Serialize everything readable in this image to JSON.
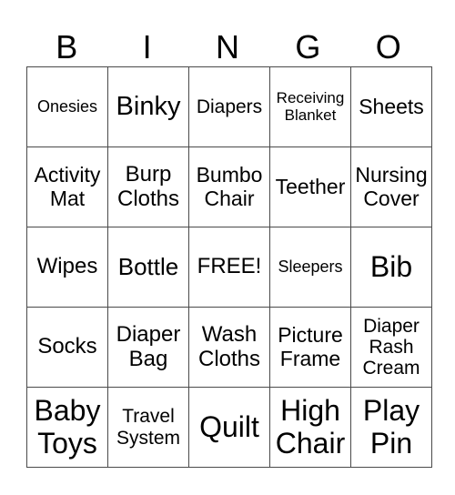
{
  "header": {
    "letters": [
      "B",
      "I",
      "N",
      "G",
      "O"
    ]
  },
  "grid": {
    "rows": [
      [
        "Onesies",
        "Binky",
        "Diapers",
        "Receiving Blanket",
        "Sheets"
      ],
      [
        "Activity Mat",
        "Burp Cloths",
        "Bumbo Chair",
        "Teether",
        "Nursing Cover"
      ],
      [
        "Wipes",
        "Bottle",
        "FREE!",
        "Sleepers",
        "Bib"
      ],
      [
        "Socks",
        "Diaper Bag",
        "Wash Cloths",
        "Picture Frame",
        "Diaper Rash Cream"
      ],
      [
        "Baby Toys",
        "Travel System",
        "Quilt",
        "High Chair",
        "Play Pin"
      ]
    ]
  }
}
